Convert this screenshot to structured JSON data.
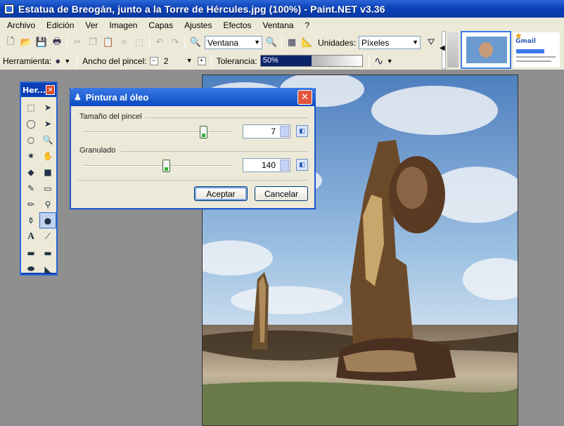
{
  "window": {
    "title": "Estatua de Breogán, junto a la Torre de Hércules.jpg (100%) - Paint.NET v3.36"
  },
  "menu": [
    "Archivo",
    "Edición",
    "Ver",
    "Imagen",
    "Capas",
    "Ajustes",
    "Efectos",
    "Ventana",
    "?"
  ],
  "toolbar": {
    "zoom_mode": "Ventana",
    "units_label": "Unidades:",
    "units_value": "Píxeles"
  },
  "toolbar2": {
    "tool_label": "Herramienta:",
    "brush_width_label": "Ancho del pincel:",
    "brush_width_value": "2",
    "tolerance_label": "Tolerancia:",
    "tolerance_value": "50%",
    "tolerance_fraction": 0.5
  },
  "tools_panel": {
    "title": "Her..."
  },
  "dialog": {
    "title": "Pintura al óleo",
    "brush_size": {
      "label": "Tamaño del pincel",
      "value": "7",
      "fraction": 0.8
    },
    "coarseness": {
      "label": "Granulado",
      "value": "140",
      "fraction": 0.55
    },
    "ok_label": "Aceptar",
    "cancel_label": "Cancelar"
  },
  "thumbnails": {
    "gmail_label": "Gmail"
  },
  "colors": {
    "title_blue": "#0a3fb5",
    "dialog_bg": "#ece9d8",
    "tolerance_fill": "#0a246a"
  }
}
